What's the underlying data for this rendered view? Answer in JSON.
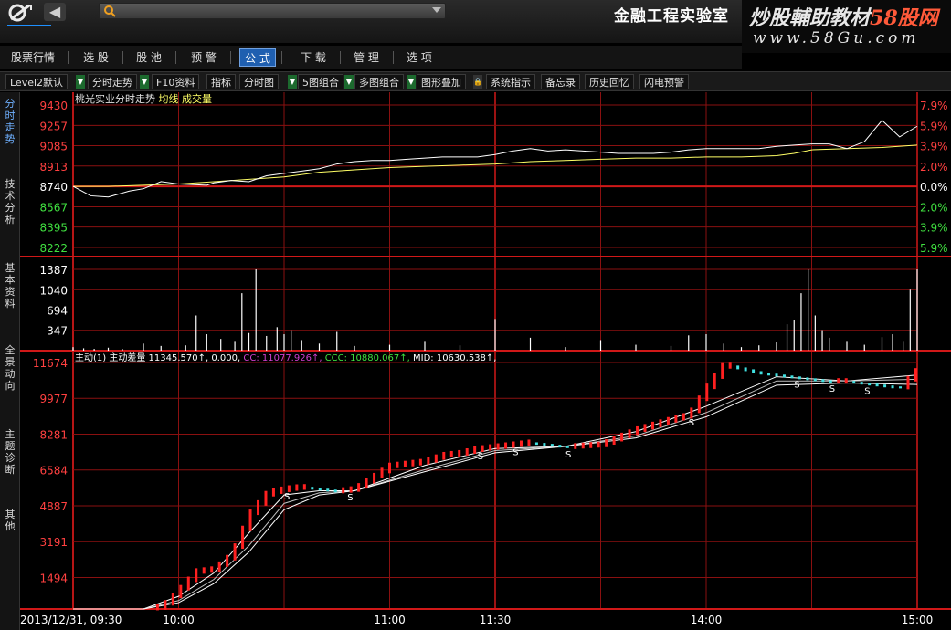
{
  "titlebar": {
    "lab_title": "金融工程实验室",
    "watermark_line1_a": "炒股輔助教材",
    "watermark_line1_b": "58股网",
    "watermark_line2": "www.58Gu.com"
  },
  "main_menu": {
    "items": [
      "股票行情",
      "选 股",
      "股 池",
      "预 警",
      "公 式",
      "下 载",
      "管 理",
      "选 项"
    ],
    "selected": "公 式"
  },
  "toolbar": {
    "items": [
      "Level2默认",
      "分时走势",
      "F10资料",
      "指标",
      "分时图",
      "5图组合",
      "多图组合",
      "图形叠加",
      "系统指示",
      "备忘录",
      "历史回忆",
      "闪电预警"
    ]
  },
  "side_tabs": [
    {
      "label": "分时走势",
      "selected": true
    },
    {
      "label": "技术分析",
      "selected": false
    },
    {
      "label": "基本资料",
      "selected": false
    },
    {
      "label": "全景动向",
      "selected": false
    },
    {
      "label": "主题诊断",
      "selected": false
    },
    {
      "label": "其他",
      "selected": false
    }
  ],
  "colors": {
    "grid": "#8a1010",
    "grid_major": "#d01818",
    "price_line": "#ffffff",
    "avg_line": "#ffff66",
    "up_text": "#ff4040",
    "down_text": "#40e040",
    "neutral_text": "#ffffff",
    "cyan": "#40e0e0",
    "magenta": "#d040d0",
    "label_blue": "#6fb0ff",
    "candle_up": "#ff2020",
    "candle_down": "#40e0e0"
  },
  "price_panel": {
    "title": "桃光实业分时走势",
    "legend_avg": "均线",
    "legend_vol": "成交量",
    "left_ticks": [
      "9430",
      "9257",
      "9085",
      "8913",
      "8740",
      "8567",
      "8395",
      "8222"
    ],
    "right_ticks": [
      "7.9%",
      "5.9%",
      "3.9%",
      "2.0%",
      "0.0%",
      "2.0%",
      "3.9%",
      "5.9%"
    ],
    "base_price": 8740
  },
  "volume_panel": {
    "left_ticks": [
      "1387",
      "1040",
      "694",
      "347"
    ]
  },
  "indicator_panel": {
    "header_name": "主动(1)",
    "header_label": "主动差量",
    "main_value": "11345.570↑,",
    "zero_value": "0.000,",
    "cc_label": "CC:",
    "cc_value": "11077.926↑,",
    "ccc_label": "CCC:",
    "ccc_value": "10880.067↑,",
    "mid_label": "MID:",
    "mid_value": "10630.538↑,",
    "left_ticks": [
      "11674",
      "9977",
      "8281",
      "6584",
      "4887",
      "3191",
      "1494"
    ],
    "sell_marker": "S"
  },
  "time_axis": {
    "labels": [
      "2013/12/31, 09:30",
      "10:00",
      "11:00",
      "11:30",
      "14:00",
      "15:00"
    ]
  },
  "chart_data": [
    {
      "type": "line",
      "title": "桃光实业分时走势",
      "xlabel": "",
      "ylabel": "",
      "ylim": [
        8222,
        9430
      ],
      "grid": true,
      "series": [
        {
          "name": "",
          "x": [
            0,
            5,
            10,
            16,
            20,
            25,
            30,
            38,
            40,
            45,
            50,
            55,
            60,
            65,
            70,
            75,
            80,
            85,
            90,
            95,
            100,
            105,
            110,
            115,
            120,
            125,
            130,
            135,
            140,
            145,
            150,
            155,
            160,
            165,
            170,
            175,
            180,
            185,
            190,
            195,
            200,
            205,
            210,
            215,
            220,
            225,
            230,
            235,
            240
          ],
          "values": [
            8740,
            8660,
            8650,
            8700,
            8720,
            8780,
            8760,
            8750,
            8770,
            8790,
            8780,
            8830,
            8850,
            8870,
            8890,
            8930,
            8950,
            8960,
            8960,
            8970,
            8980,
            8990,
            8990,
            8990,
            9010,
            9040,
            9060,
            9040,
            9050,
            9040,
            9030,
            9020,
            9020,
            9020,
            9030,
            9050,
            9060,
            9060,
            9060,
            9060,
            9080,
            9090,
            9100,
            9100,
            9060,
            9120,
            9300,
            9160,
            9250
          ]
        }
      ]
    },
    {
      "type": "line",
      "title": "",
      "xlabel": "",
      "ylabel": "",
      "grid": true,
      "series": [
        {
          "name": "",
          "x": [
            0,
            10,
            20,
            30,
            40,
            50,
            60,
            70,
            80,
            90,
            100,
            110,
            120,
            130,
            140,
            150,
            160,
            170,
            180,
            190,
            200,
            205,
            210,
            220,
            230,
            240
          ],
          "values": [
            8740,
            8740,
            8750,
            8760,
            8780,
            8800,
            8820,
            8860,
            8880,
            8900,
            8910,
            8920,
            8930,
            8950,
            8960,
            8970,
            8980,
            8980,
            8990,
            8990,
            9000,
            9020,
            9050,
            9060,
            9070,
            9090
          ]
        }
      ]
    },
    {
      "type": "bar",
      "title": "",
      "xlabel": "",
      "ylabel": "",
      "ylim": [
        0,
        1387
      ],
      "grid": true,
      "x": [
        0,
        3,
        6,
        10,
        14,
        20,
        25,
        32,
        35,
        38,
        42,
        46,
        48,
        50,
        52,
        55,
        58,
        60,
        62,
        65,
        70,
        75,
        80,
        90,
        100,
        110,
        120,
        130,
        140,
        150,
        160,
        170,
        175,
        180,
        185,
        190,
        195,
        200,
        203,
        205,
        207,
        209,
        211,
        213,
        215,
        220,
        225,
        230,
        233,
        236,
        238,
        240
      ],
      "values": [
        60,
        40,
        30,
        50,
        30,
        120,
        80,
        90,
        600,
        280,
        200,
        150,
        980,
        300,
        1387,
        250,
        400,
        280,
        350,
        180,
        120,
        320,
        80,
        100,
        150,
        90,
        540,
        220,
        60,
        180,
        100,
        80,
        260,
        280,
        120,
        60,
        90,
        140,
        450,
        520,
        980,
        1387,
        600,
        350,
        220,
        150,
        100,
        230,
        280,
        150,
        1040,
        1387
      ]
    },
    {
      "type": "line",
      "title": "",
      "xlabel": "",
      "ylabel": "",
      "ylim": [
        0,
        11674
      ],
      "grid": true,
      "series": [
        {
          "name": "",
          "x": [
            0,
            15,
            25,
            30,
            35,
            40,
            45,
            50,
            55,
            60,
            65,
            70,
            75,
            80,
            90,
            95,
            100,
            105,
            110,
            115,
            120,
            125,
            130,
            135,
            140,
            150,
            160,
            170,
            175,
            180,
            185,
            190,
            195,
            200,
            205,
            210,
            215,
            220,
            225,
            230,
            235,
            240
          ],
          "values": [
            0,
            0,
            100,
            900,
            1800,
            1900,
            2600,
            4500,
            5500,
            5700,
            5800,
            5700,
            5600,
            5700,
            6800,
            6900,
            7000,
            7300,
            7400,
            7600,
            7700,
            7800,
            7900,
            7800,
            7700,
            7800,
            8500,
            9000,
            9200,
            10500,
            11600,
            11400,
            11200,
            11100,
            11000,
            10900,
            10800,
            10800,
            10700,
            10600,
            10500,
            11345
          ]
        },
        {
          "name": "CC",
          "x": [
            0,
            20,
            30,
            40,
            50,
            60,
            70,
            80,
            100,
            120,
            140,
            160,
            180,
            200,
            220,
            240
          ],
          "values": [
            0,
            0,
            600,
            1700,
            3600,
            5400,
            5600,
            5600,
            6800,
            7600,
            7700,
            8400,
            9600,
            11000,
            10800,
            11078
          ]
        },
        {
          "name": "CCC",
          "x": [
            0,
            20,
            30,
            40,
            50,
            60,
            70,
            80,
            100,
            120,
            140,
            160,
            180,
            200,
            220,
            240
          ],
          "values": [
            0,
            0,
            400,
            1400,
            3000,
            5000,
            5500,
            5600,
            6600,
            7500,
            7700,
            8200,
            9300,
            10800,
            10800,
            10880
          ]
        },
        {
          "name": "MID",
          "x": [
            0,
            20,
            30,
            40,
            50,
            60,
            70,
            80,
            100,
            120,
            140,
            160,
            180,
            200,
            220,
            240
          ],
          "values": [
            0,
            0,
            300,
            1200,
            2700,
            4700,
            5400,
            5600,
            6500,
            7400,
            7700,
            8100,
            9100,
            10600,
            10700,
            10631
          ]
        }
      ]
    }
  ]
}
